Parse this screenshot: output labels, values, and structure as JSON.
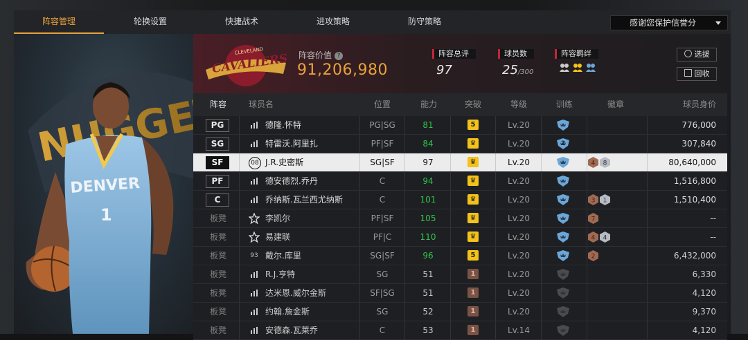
{
  "tabs": [
    {
      "label": "阵容管理",
      "active": true
    },
    {
      "label": "轮换设置",
      "active": false
    },
    {
      "label": "快捷战术",
      "active": false
    },
    {
      "label": "进攻策略",
      "active": false
    },
    {
      "label": "防守策略",
      "active": false
    }
  ],
  "dropdown": {
    "label": "感谢您保护信誉分"
  },
  "team": {
    "logo_text": "CAVALIERS",
    "logo_subtext": "CLEVELAND",
    "lineup_value_label": "阵容价值",
    "lineup_value": "91,206,980",
    "rating_label": "阵容总评",
    "rating_value": "97",
    "players_label": "球员数",
    "players_value": "25",
    "players_max": "/300",
    "bond_label": "阵容羁绊",
    "bond_icons": [
      "team-bond-icon",
      "team-bond-icon",
      "team-bond-icon"
    ]
  },
  "buttons": {
    "select": "选拔",
    "recycle": "回收"
  },
  "table": {
    "headers": {
      "lineup": "阵容",
      "name": "球员名",
      "position": "位置",
      "ability": "能力",
      "breakthrough": "突破",
      "level": "等级",
      "training": "训练",
      "badge": "徽章",
      "value": "球员身价"
    },
    "rows": [
      {
        "slot": "PG",
        "bench": false,
        "icon": "bars",
        "name": "德隆.怀特",
        "position": "PG|SG",
        "ability": "81",
        "ability_green": true,
        "break_type": "gold",
        "break_text": "5",
        "level": "Lv.20",
        "train": "blue",
        "train_num": "",
        "badges": [],
        "value": "776,000",
        "selected": false
      },
      {
        "slot": "SG",
        "bench": false,
        "icon": "bars",
        "name": "特雷沃.阿里扎",
        "position": "PF|SF",
        "ability": "84",
        "ability_green": true,
        "break_type": "gold",
        "break_text": "♛",
        "level": "Lv.20",
        "train": "blue",
        "train_num": "2",
        "badges": [],
        "value": "307,840",
        "selected": false
      },
      {
        "slot": "SF",
        "bench": false,
        "icon": "number",
        "icon_text": "08",
        "name": "J.R.史密斯",
        "position": "SG|SF",
        "ability": "97",
        "ability_green": false,
        "break_type": "gold",
        "break_text": "♛",
        "level": "Lv.20",
        "train": "blue",
        "train_num": "",
        "badges": [
          {
            "type": "bronze",
            "text": "4"
          },
          {
            "type": "silver",
            "text": "8"
          }
        ],
        "value": "80,640,000",
        "selected": true
      },
      {
        "slot": "PF",
        "bench": false,
        "icon": "bars",
        "name": "德安德烈.乔丹",
        "position": "C",
        "ability": "94",
        "ability_green": true,
        "break_type": "gold",
        "break_text": "♛",
        "level": "Lv.20",
        "train": "blue",
        "train_num": "",
        "badges": [],
        "value": "1,516,800",
        "selected": false
      },
      {
        "slot": "C",
        "bench": false,
        "icon": "bars",
        "name": "乔纳斯.瓦兰西尤纳斯",
        "position": "C",
        "ability": "101",
        "ability_green": true,
        "break_type": "gold",
        "break_text": "♛",
        "level": "Lv.20",
        "train": "blue",
        "train_num": "",
        "badges": [
          {
            "type": "bronze",
            "text": "3"
          },
          {
            "type": "silver",
            "text": "1"
          }
        ],
        "value": "1,510,400",
        "selected": false
      },
      {
        "slot": "板凳",
        "bench": true,
        "icon": "star",
        "name": "李凯尔",
        "position": "PF|SF",
        "ability": "105",
        "ability_green": true,
        "break_type": "gold",
        "break_text": "♛",
        "level": "Lv.20",
        "train": "blue",
        "train_num": "",
        "badges": [
          {
            "type": "bronze",
            "text": "7"
          }
        ],
        "value": "--",
        "selected": false
      },
      {
        "slot": "板凳",
        "bench": true,
        "icon": "star",
        "name": "易建联",
        "position": "PF|C",
        "ability": "110",
        "ability_green": true,
        "break_type": "gold",
        "break_text": "♛",
        "level": "Lv.20",
        "train": "blue",
        "train_num": "",
        "badges": [
          {
            "type": "bronze",
            "text": "4"
          },
          {
            "type": "silver",
            "text": "4"
          }
        ],
        "value": "--",
        "selected": false
      },
      {
        "slot": "板凳",
        "bench": true,
        "icon": "plain",
        "icon_text": "93",
        "name": "戴尔.库里",
        "position": "SG|SF",
        "ability": "96",
        "ability_green": true,
        "break_type": "gold",
        "break_text": "5",
        "level": "Lv.20",
        "train": "blue",
        "train_num": "",
        "badges": [
          {
            "type": "bronze",
            "text": "2"
          }
        ],
        "value": "6,432,000",
        "selected": false
      },
      {
        "slot": "板凳",
        "bench": true,
        "icon": "bars",
        "name": "R.J.亨特",
        "position": "SG",
        "ability": "51",
        "ability_green": false,
        "break_type": "bronze",
        "break_text": "1",
        "level": "Lv.20",
        "train": "gray",
        "train_num": "",
        "badges": [],
        "value": "6,330",
        "selected": false
      },
      {
        "slot": "板凳",
        "bench": true,
        "icon": "bars",
        "name": "达米恩.威尔金斯",
        "position": "SF|SG",
        "ability": "51",
        "ability_green": false,
        "break_type": "bronze",
        "break_text": "1",
        "level": "Lv.20",
        "train": "gray",
        "train_num": "",
        "badges": [],
        "value": "4,120",
        "selected": false
      },
      {
        "slot": "板凳",
        "bench": true,
        "icon": "bars",
        "name": "约翰.詹金斯",
        "position": "SG",
        "ability": "52",
        "ability_green": false,
        "break_type": "bronze",
        "break_text": "1",
        "level": "Lv.20",
        "train": "gray",
        "train_num": "",
        "badges": [],
        "value": "9,370",
        "selected": false
      },
      {
        "slot": "板凳",
        "bench": true,
        "icon": "bars",
        "name": "安德森.瓦莱乔",
        "position": "C",
        "ability": "53",
        "ability_green": false,
        "break_type": "bronze",
        "break_text": "1",
        "level": "Lv.14",
        "train": "gray",
        "train_num": "",
        "badges": [],
        "value": "4,120",
        "selected": false
      }
    ]
  },
  "player_card": {
    "jersey_team": "DENVER",
    "jersey_number": "1",
    "bg_text": "NUGGETS"
  },
  "colors": {
    "accent": "#e9a23b",
    "green": "#2fc54a",
    "red": "#c3263a",
    "gold": "#f3c21b",
    "bronze": "#7a5344",
    "train_blue": "#6ba6d6"
  }
}
